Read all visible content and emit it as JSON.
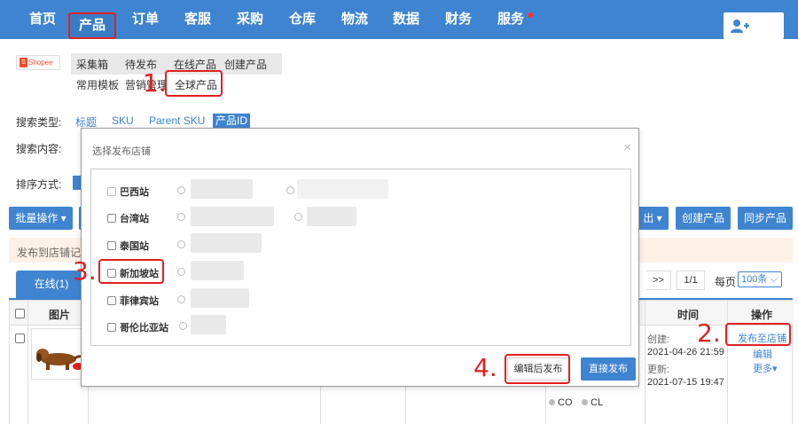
{
  "nav": {
    "items": [
      "首页",
      "产品",
      "订单",
      "客服",
      "采购",
      "仓库",
      "物流",
      "数据",
      "财务",
      "服务"
    ],
    "active_index": 1,
    "user_icon": "add-user-icon"
  },
  "platform": {
    "badge": "Shopee"
  },
  "subtabs": {
    "row1": [
      "采集箱",
      "待发布",
      "在线产品",
      "创建产品"
    ],
    "row2": [
      "常用模板",
      "营销管理",
      "全球产品"
    ]
  },
  "search": {
    "type_label": "搜索类型:",
    "type_options": [
      "标题",
      "SKU",
      "Parent SKU",
      "产品ID"
    ],
    "selected_type": "产品ID",
    "content_label": "搜索内容:",
    "sort_label": "排序方式:"
  },
  "toolbar": {
    "batch_label": "批量操作",
    "export_label": "出",
    "create_label": "创建产品",
    "sync_label": "同步产品"
  },
  "notice": {
    "text": "发布到店铺记录"
  },
  "listing_tabs": {
    "online": "在线(1)"
  },
  "pager": {
    "next": ">>",
    "page": "1/1",
    "per_page_label": "每页",
    "per_page_value": "100条"
  },
  "table": {
    "headers": {
      "image": "图片",
      "time": "时间",
      "action": "操作"
    },
    "row": {
      "created_label": "创建:",
      "created": "2021-04-26 21:59",
      "updated_label": "更新:",
      "updated": "2021-07-15 19:47",
      "actions": [
        "发布至店铺",
        "编辑",
        "更多"
      ],
      "chips": [
        "CO",
        "CL"
      ]
    }
  },
  "modal": {
    "title": "选择发布店铺",
    "close_icon": "close-icon",
    "sites": [
      "巴西站",
      "台湾站",
      "泰国站",
      "新加坡站",
      "菲律宾站",
      "哥伦比亚站"
    ],
    "edit_button": "编辑后发布",
    "publish_button": "直接发布"
  },
  "annotations": [
    "1.",
    "2.",
    "3.",
    "4."
  ]
}
